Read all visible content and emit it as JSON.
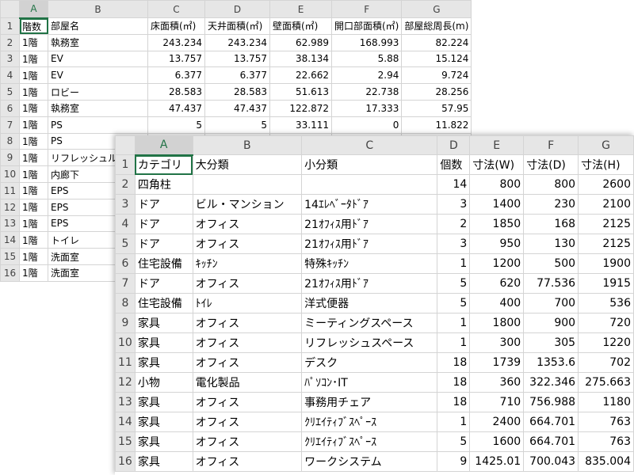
{
  "back_sheet": {
    "columns": [
      "A",
      "B",
      "C",
      "D",
      "E",
      "F",
      "G"
    ],
    "rows": [
      [
        "1",
        "階数",
        "部屋名",
        "床面積(㎡)",
        "天井面積(㎡)",
        "壁面積(㎡)",
        "開口部面積(㎡)",
        "部屋総周長(m)"
      ],
      [
        "2",
        "1階",
        "執務室",
        "243.234",
        "243.234",
        "62.989",
        "168.993",
        "82.224"
      ],
      [
        "3",
        "1階",
        "EV",
        "13.757",
        "13.757",
        "38.134",
        "5.88",
        "15.124"
      ],
      [
        "4",
        "1階",
        "EV",
        "6.377",
        "6.377",
        "22.662",
        "2.94",
        "9.724"
      ],
      [
        "5",
        "1階",
        "ロビー",
        "28.583",
        "28.583",
        "51.613",
        "22.738",
        "28.256"
      ],
      [
        "6",
        "1階",
        "執務室",
        "47.437",
        "47.437",
        "122.872",
        "17.333",
        "57.95"
      ],
      [
        "7",
        "1階",
        "PS",
        "5",
        "5",
        "33.111",
        "0",
        "11.822"
      ],
      [
        "8",
        "1階",
        "PS",
        "",
        "",
        "",
        "",
        ""
      ],
      [
        "9",
        "1階",
        "リフレッシュル",
        "",
        "",
        "",
        "",
        ""
      ],
      [
        "10",
        "1階",
        "内廊下",
        "",
        "",
        "",
        "",
        ""
      ],
      [
        "11",
        "1階",
        "EPS",
        "",
        "",
        "",
        "",
        ""
      ],
      [
        "12",
        "1階",
        "EPS",
        "",
        "",
        "",
        "",
        ""
      ],
      [
        "13",
        "1階",
        "EPS",
        "",
        "",
        "",
        "",
        ""
      ],
      [
        "14",
        "1階",
        "トイレ",
        "",
        "",
        "",
        "",
        ""
      ],
      [
        "15",
        "1階",
        "洗面室",
        "",
        "",
        "",
        "",
        ""
      ],
      [
        "16",
        "1階",
        "洗面室",
        "",
        "",
        "",
        "",
        ""
      ]
    ]
  },
  "front_sheet": {
    "columns": [
      "A",
      "B",
      "C",
      "D",
      "E",
      "F",
      "G"
    ],
    "rows": [
      [
        "1",
        "カテゴリ",
        "大分類",
        "小分類",
        "個数",
        "寸法(W)",
        "寸法(D)",
        "寸法(H)"
      ],
      [
        "2",
        "四角柱",
        "",
        "",
        "14",
        "800",
        "800",
        "2600"
      ],
      [
        "3",
        "ドア",
        "ビル・マンション",
        "14ｴﾚﾍﾞｰﾀﾄﾞｱ",
        "3",
        "1400",
        "230",
        "2100"
      ],
      [
        "4",
        "ドア",
        "オフィス",
        "21ｵﾌｨｽ用ﾄﾞｱ",
        "2",
        "1850",
        "168",
        "2125"
      ],
      [
        "5",
        "ドア",
        "オフィス",
        "21ｵﾌｨｽ用ﾄﾞｱ",
        "3",
        "950",
        "130",
        "2125"
      ],
      [
        "6",
        "住宅設備",
        "ｷｯﾁﾝ",
        "特殊ｷｯﾁﾝ",
        "1",
        "1200",
        "500",
        "1900"
      ],
      [
        "7",
        "ドア",
        "オフィス",
        "21ｵﾌｨｽ用ﾄﾞｱ",
        "5",
        "620",
        "77.536",
        "1915"
      ],
      [
        "8",
        "住宅設備",
        "ﾄｲﾚ",
        "洋式便器",
        "5",
        "400",
        "700",
        "536"
      ],
      [
        "9",
        "家具",
        "オフィス",
        "ミーティングスペース",
        "1",
        "1800",
        "900",
        "720"
      ],
      [
        "10",
        "家具",
        "オフィス",
        "リフレッシュスペース",
        "1",
        "300",
        "305",
        "1220"
      ],
      [
        "11",
        "家具",
        "オフィス",
        "デスク",
        "18",
        "1739",
        "1353.6",
        "702"
      ],
      [
        "12",
        "小物",
        "電化製品",
        "ﾊﾟｿｺﾝ･IT",
        "18",
        "360",
        "322.346",
        "275.663"
      ],
      [
        "13",
        "家具",
        "オフィス",
        "事務用チェア",
        "18",
        "710",
        "756.988",
        "1180"
      ],
      [
        "14",
        "家具",
        "オフィス",
        "ｸﾘｴｲﾃｨﾌﾞｽﾍﾟｰｽ",
        "1",
        "2400",
        "664.701",
        "763"
      ],
      [
        "15",
        "家具",
        "オフィス",
        "ｸﾘｴｲﾃｨﾌﾞｽﾍﾟｰｽ",
        "5",
        "1600",
        "664.701",
        "763"
      ],
      [
        "16",
        "家具",
        "オフィス",
        "ワークシステム",
        "9",
        "1425.01",
        "700.043",
        "835.004"
      ]
    ]
  }
}
